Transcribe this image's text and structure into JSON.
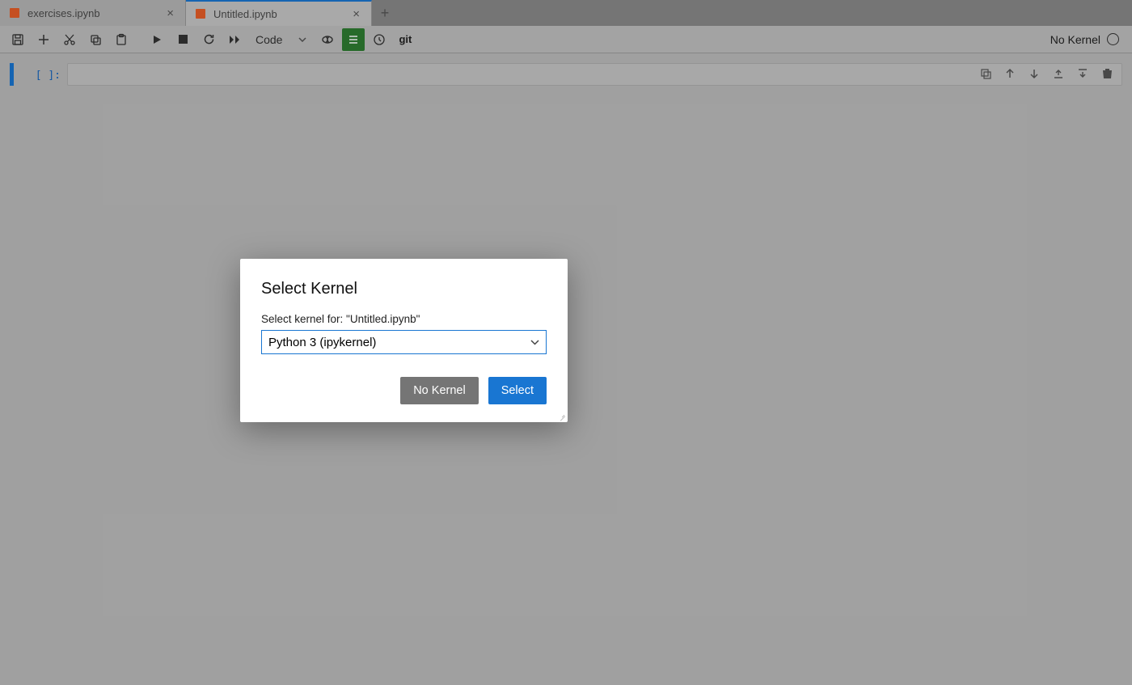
{
  "tabs": {
    "items": [
      {
        "label": "exercises.ipynb"
      },
      {
        "label": "Untitled.ipynb"
      }
    ],
    "active_index": 1
  },
  "toolbar": {
    "cell_type": "Code",
    "git_label": "git"
  },
  "kernel_status": {
    "label": "No Kernel"
  },
  "cell": {
    "prompt": "[ ]:"
  },
  "dialog": {
    "title": "Select Kernel",
    "label": "Select kernel for: \"Untitled.ipynb\"",
    "selected_option": "Python 3 (ipykernel)",
    "no_kernel_label": "No Kernel",
    "select_label": "Select"
  }
}
